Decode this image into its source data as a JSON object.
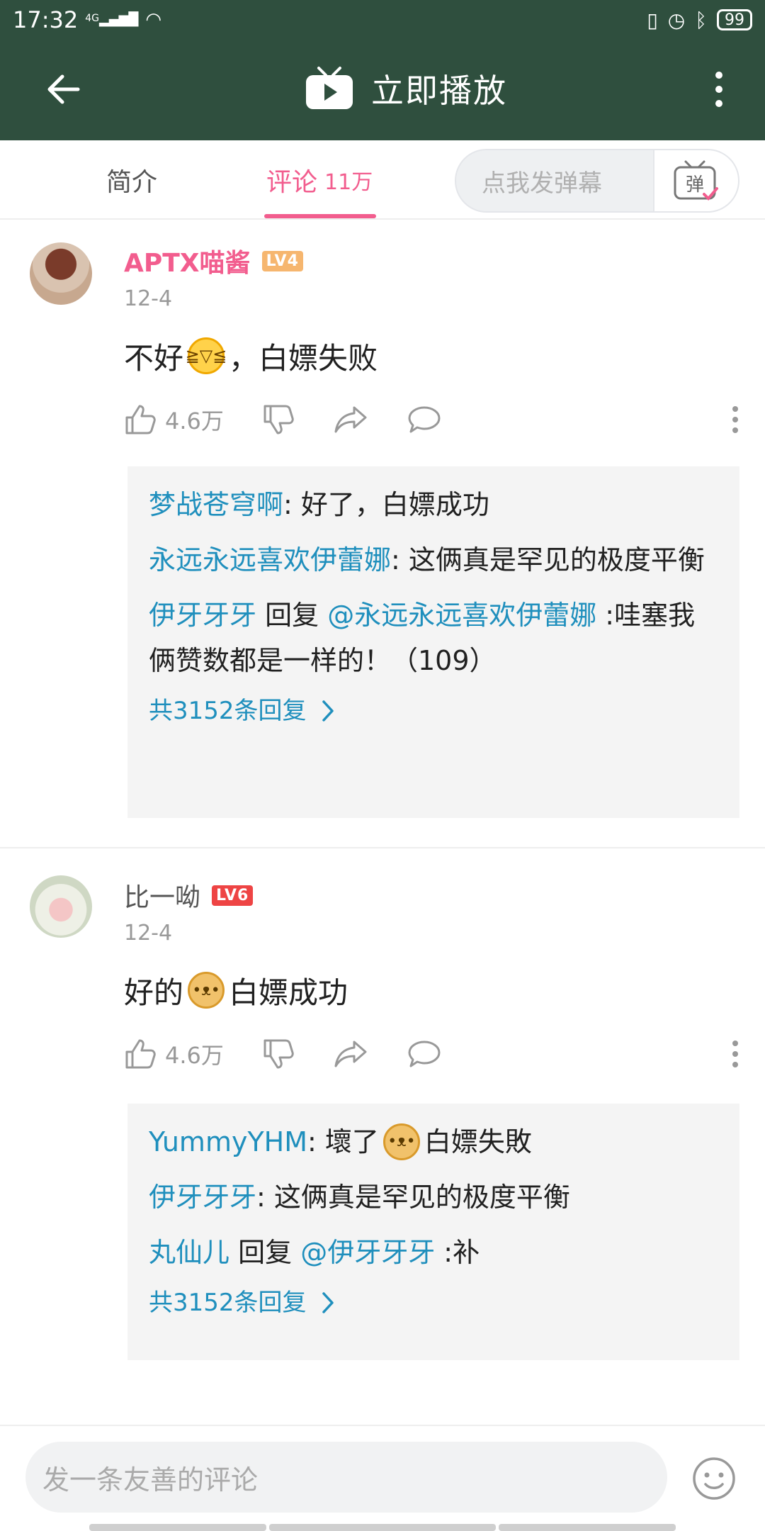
{
  "status": {
    "time": "17:32",
    "network": "4G",
    "battery": "99"
  },
  "header": {
    "title": "立即播放"
  },
  "tabs": {
    "intro": "简介",
    "comments": "评论",
    "comments_count": "11万"
  },
  "danmaku": {
    "placeholder": "点我发弹幕",
    "button": "弹"
  },
  "comments": [
    {
      "user": "APTX喵酱",
      "level": "LV4",
      "date": "12-4",
      "text_before": "不好",
      "text_after": "，白嫖失败",
      "likes": "4.6万",
      "replies": [
        {
          "user": "梦战苍穹啊",
          "text": ": 好了，白嫖成功"
        },
        {
          "user": "永远永远喜欢伊蕾娜",
          "text": ": 这俩真是罕见的极度平衡"
        },
        {
          "user": "伊牙牙牙",
          "reply_word": " 回复 ",
          "mention": "@永远永远喜欢伊蕾娜",
          "text": " :哇塞我俩赞数都是一样的！（109）"
        }
      ],
      "total": "共3152条回复"
    },
    {
      "user": "比一呦",
      "level": "LV6",
      "date": "12-4",
      "text_before": "好的",
      "text_after": "白嫖成功",
      "likes": "4.6万",
      "replies": [
        {
          "user": "YummyYHM",
          "text_before": ": 壞了",
          "text_after": " 白嫖失敗"
        },
        {
          "user": "伊牙牙牙",
          "text": ": 这俩真是罕见的极度平衡"
        },
        {
          "user": "丸仙儿",
          "reply_word": " 回复 ",
          "mention": "@伊牙牙牙",
          "text": " :补"
        }
      ],
      "total": "共3152条回复"
    }
  ],
  "input": {
    "placeholder": "发一条友善的评论"
  },
  "colors": {
    "header": "#2f4f3e",
    "accent": "#f25d8e",
    "link": "#1f8fbd"
  },
  "icons": [
    "back-arrow-icon",
    "tv-play-icon",
    "more-vertical-icon",
    "like-icon",
    "dislike-icon",
    "share-icon",
    "reply-icon",
    "chevron-right-icon",
    "emoji-face-icon"
  ]
}
